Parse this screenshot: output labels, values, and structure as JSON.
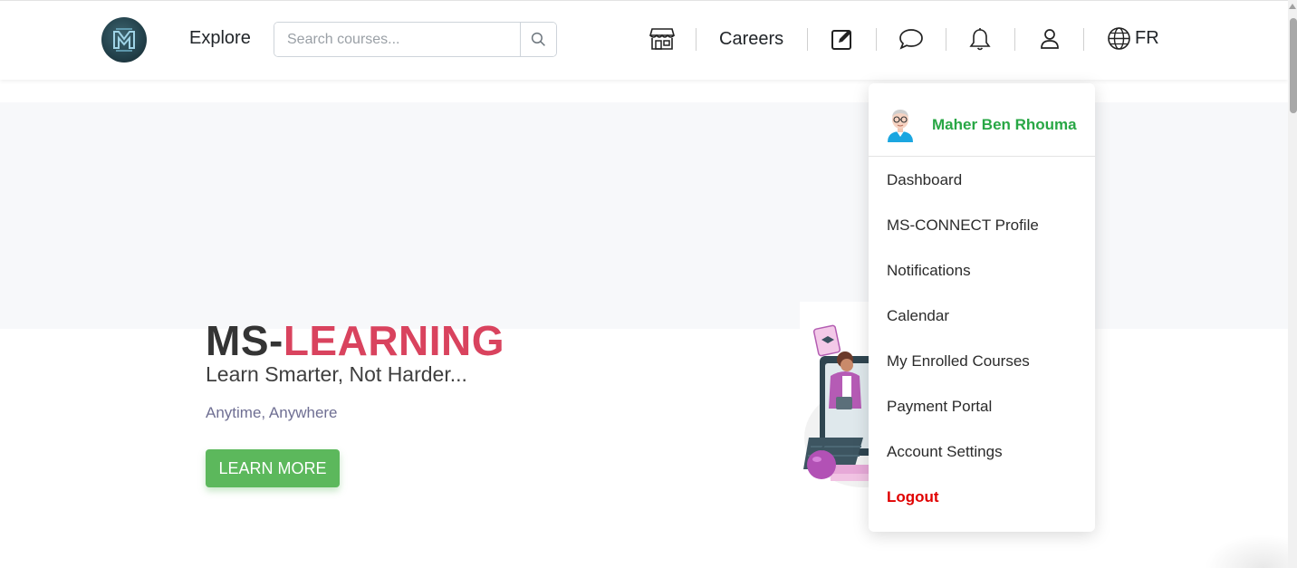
{
  "navbar": {
    "explore_label": "Explore",
    "search_placeholder": "Search courses...",
    "careers_label": "Careers",
    "language_label": "FR",
    "icons": [
      "store-icon",
      "edit-icon",
      "chat-icon",
      "bell-icon",
      "user-icon",
      "globe-icon",
      "search-icon"
    ]
  },
  "hero": {
    "title_prefix": "MS-",
    "title_highlight": "LEARNING",
    "subtitle": "Learn Smarter, Not Harder...",
    "tagline": "Anytime, Anywhere",
    "cta_label": "LEARN MORE"
  },
  "user_menu": {
    "user_name": "Maher Ben Rhouma",
    "items": [
      {
        "label": "Dashboard"
      },
      {
        "label": "MS-CONNECT Profile"
      },
      {
        "label": "Notifications"
      },
      {
        "label": "Calendar"
      },
      {
        "label": "My Enrolled Courses"
      },
      {
        "label": "Payment Portal"
      },
      {
        "label": "Account Settings"
      }
    ],
    "logout_label": "Logout"
  },
  "colors": {
    "accent_red": "#d9435e",
    "cta_green": "#5cb85c",
    "username_green": "#28a745",
    "logout_red": "#e00000"
  }
}
